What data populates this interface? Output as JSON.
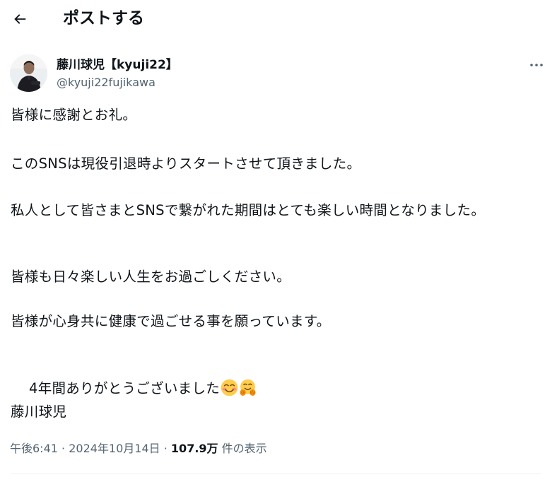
{
  "header": {
    "title": "ポストする"
  },
  "author": {
    "display_name": "藤川球児【kyuji22】",
    "handle": "@kyuji22fujikawa"
  },
  "tweet": {
    "line1": "皆様に感謝とお礼。",
    "line2": "このSNSは現役引退時よりスタートさせて頂きました。",
    "line3": "私人として皆さまとSNSで繋がれた期間はとても楽しい時間となりました。",
    "line4": "皆様も日々楽しい人生をお過ごしください。",
    "line5": "皆様が心身共に健康で過ごせる事を願っています。",
    "line6": "4年間ありがとうございました",
    "line7": "藤川球児",
    "emojis": [
      "smiling-face-with-smiling-eyes-icon",
      "hugging-face-icon"
    ]
  },
  "meta": {
    "time": "午後6:41",
    "sep1": " · ",
    "date": "2024年10月14日",
    "sep2": " · ",
    "views_count": "107.9万",
    "views_label": "件の表示"
  },
  "colors": {
    "text": "#0f1419",
    "secondary": "#536471",
    "divider": "#eff3f4"
  }
}
